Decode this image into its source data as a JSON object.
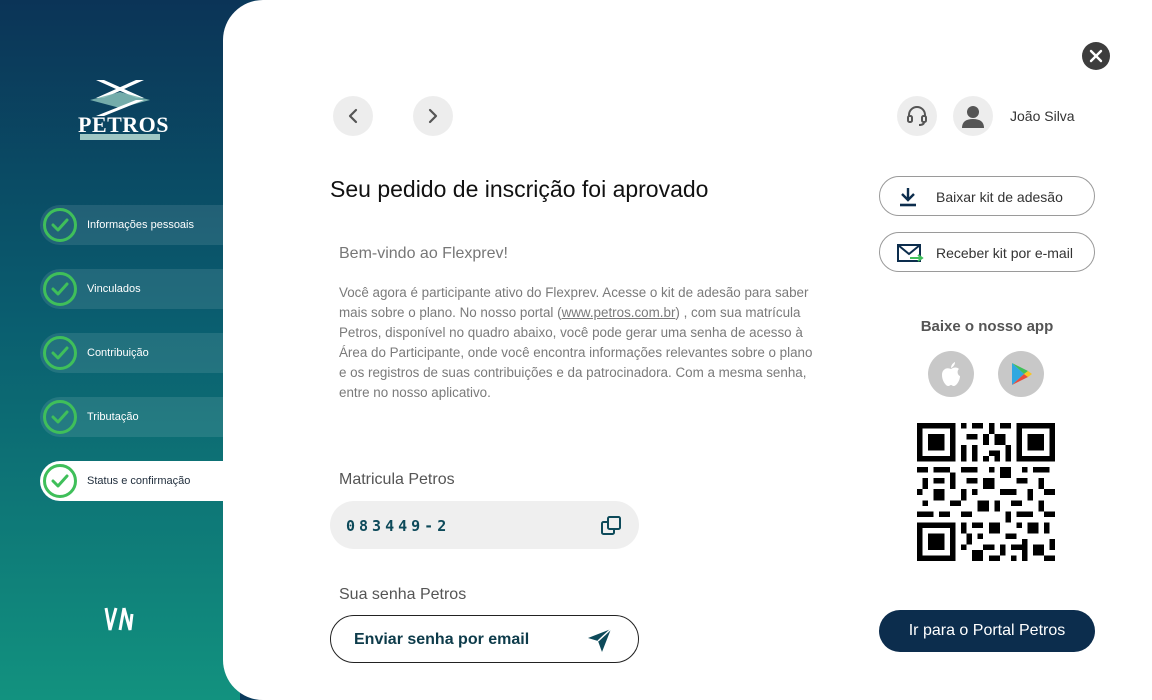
{
  "sidebar": {
    "logo_text": "PETROS",
    "steps": [
      {
        "label": "Informações pessoais"
      },
      {
        "label": "Vinculados"
      },
      {
        "label": "Contribuição"
      },
      {
        "label": "Tributação"
      },
      {
        "label": "Status e confirmação"
      }
    ],
    "active_step": 4
  },
  "header": {
    "user_name": "João Silva",
    "icons": [
      "chevron-left-icon",
      "chevron-right-icon",
      "headset-icon",
      "user-icon",
      "close-icon"
    ]
  },
  "main": {
    "title": "Seu pedido de inscrição foi aprovado",
    "welcome": "Bem-vindo ao Flexprev!",
    "body_before_link": "Você agora é participante ativo do Flexprev. Acesse o kit de adesão para saber mais sobre o plano. No nosso portal (",
    "body_link": "www.petros.com.br",
    "body_after_link": ") , com sua matrícula Petros, disponível no quadro abaixo, você pode gerar uma senha de acesso à Área do Participante, onde você encontra informações relevantes sobre o plano e os registros de suas contribuições e da patrocinadora. Com a mesma senha, entre no nosso aplicativo.",
    "matricula_label": "Matricula Petros",
    "matricula_value": "083449-2",
    "password_label": "Sua senha Petros",
    "send_password_button": "Enviar senha por email"
  },
  "aside": {
    "download_kit_button": "Baixar kit de adesão",
    "email_kit_button": "Receber kit por e-mail",
    "app_title": "Baixe o nosso app",
    "portal_button": "Ir para o Portal Petros"
  },
  "colors": {
    "accent": "#0c2d4d",
    "check": "#3fbf5a",
    "matricula": "#0d4a5a"
  }
}
